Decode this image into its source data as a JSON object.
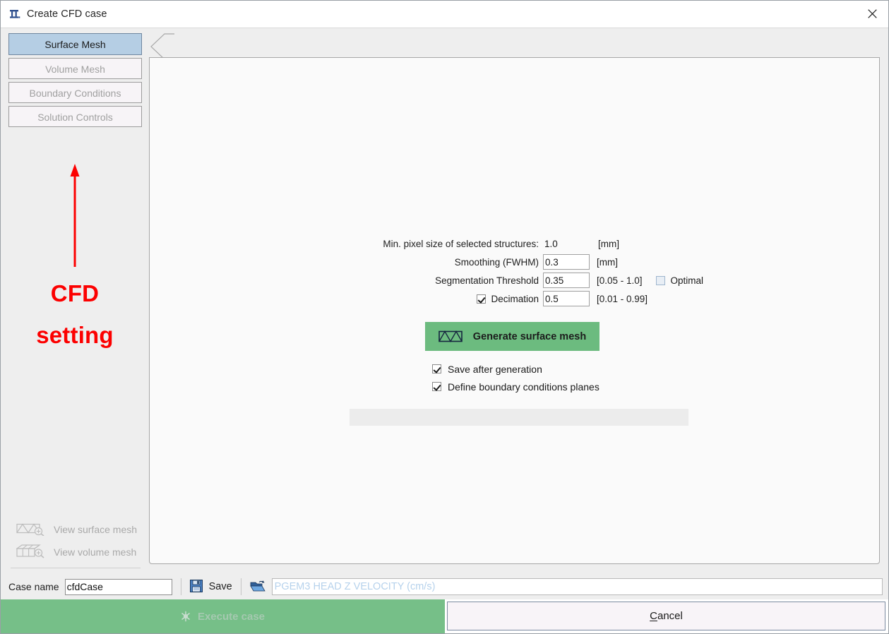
{
  "window": {
    "title": "Create CFD case",
    "icon": "mesh-table-icon",
    "close_label": "close-icon"
  },
  "sidebar": {
    "tabs": [
      {
        "label": "Surface Mesh",
        "active": true
      },
      {
        "label": "Volume Mesh",
        "active": false
      },
      {
        "label": "Boundary Conditions",
        "active": false
      },
      {
        "label": "Solution Controls",
        "active": false
      }
    ],
    "annotation": {
      "line1": "CFD",
      "line2": "setting",
      "color": "#fc0000",
      "arrow": "up-arrow"
    },
    "view_buttons": [
      {
        "label": "View surface mesh",
        "icon": "surface-mesh-zoom-icon"
      },
      {
        "label": "View volume mesh",
        "icon": "volume-mesh-zoom-icon"
      }
    ]
  },
  "form": {
    "min_pixel": {
      "label": "Min. pixel size of selected structures:",
      "value": "1.0",
      "units": "[mm]"
    },
    "smoothing": {
      "label": "Smoothing (FWHM)",
      "value": "0.3",
      "units": "[mm]"
    },
    "threshold": {
      "label": "Segmentation Threshold",
      "value": "0.35",
      "range": "[0.05 - 1.0]",
      "optimal_label": "Optimal",
      "optimal_checked": false
    },
    "decimation": {
      "label": "Decimation",
      "value": "0.5",
      "range": "[0.01 - 0.99]",
      "checked": true
    }
  },
  "generate": {
    "label": "Generate surface mesh",
    "icon": "surface-mesh-icon",
    "color": "#6cbb7f"
  },
  "options": [
    {
      "label": "Save after generation",
      "checked": true
    },
    {
      "label": "Define boundary conditions planes",
      "checked": true
    }
  ],
  "progress": {
    "value": "",
    "percent": 0
  },
  "bottom": {
    "case_name_label": "Case name",
    "case_name_value": "cfdCase",
    "save_label": "Save",
    "save_icon": "floppy-save-icon",
    "open_icon": "open-folder-icon",
    "path_placeholder": "PGEM3 HEAD Z VELOCITY (cm/s)",
    "path_value": ""
  },
  "actions": {
    "execute_label": "Execute case",
    "execute_icon": "gear-icon",
    "execute_enabled": false,
    "cancel_label_prefix": "C",
    "cancel_label_rest": "ancel"
  }
}
